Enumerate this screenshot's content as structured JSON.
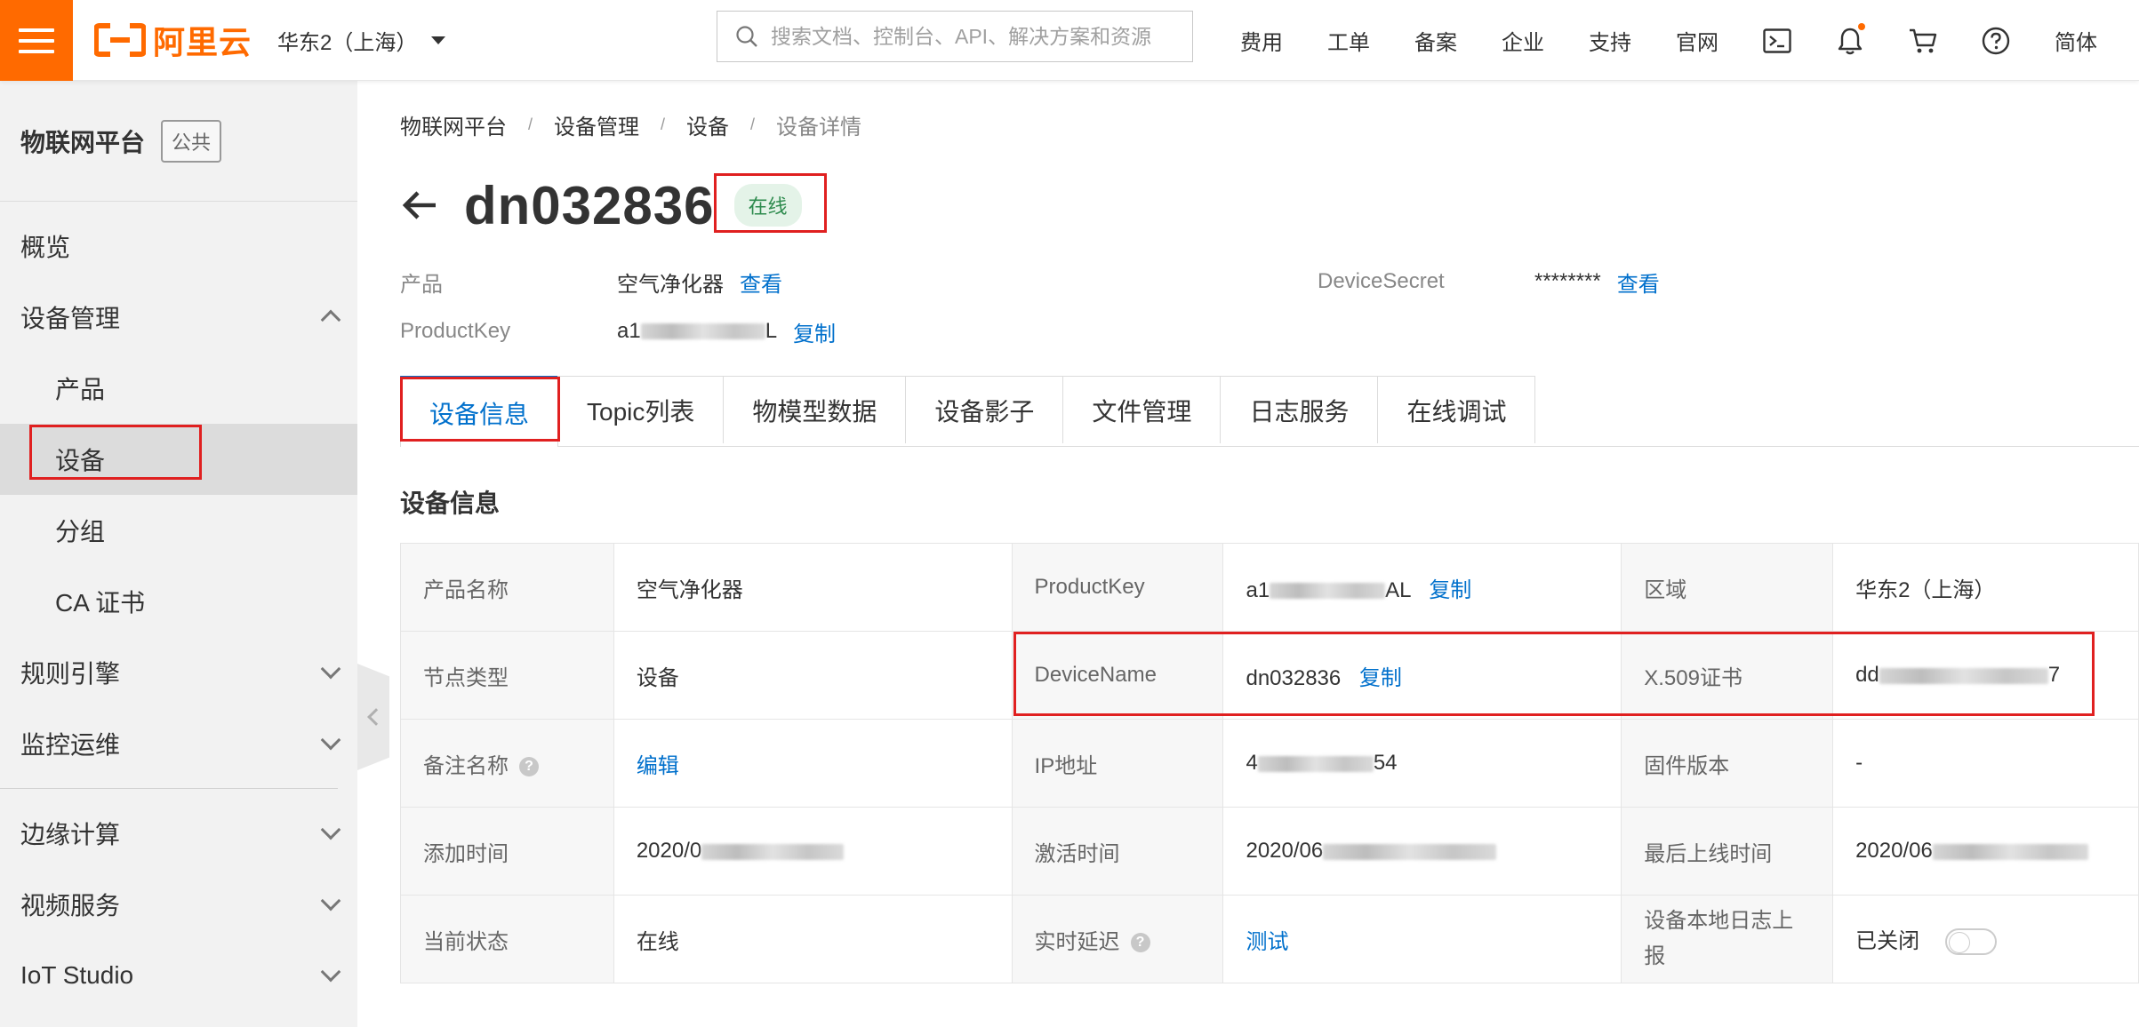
{
  "colors": {
    "brand": "#ff6a00",
    "link": "#0070cc",
    "highlight": "#e02020",
    "online": "#2e8b4e"
  },
  "topbar": {
    "logo_text": "阿里云",
    "region": "华东2（上海）",
    "search_placeholder": "搜索文档、控制台、API、解决方案和资源",
    "nav": [
      "费用",
      "工单",
      "备案",
      "企业",
      "支持",
      "官网"
    ],
    "icons": [
      "terminal-icon",
      "bell-icon",
      "cart-icon",
      "help-icon"
    ],
    "lang": "简体"
  },
  "sidebar": {
    "title": "物联网平台",
    "tag": "公共",
    "items": [
      {
        "label": "概览",
        "level": 1
      },
      {
        "label": "设备管理",
        "level": 1,
        "expanded": true
      },
      {
        "label": "产品",
        "level": 2
      },
      {
        "label": "设备",
        "level": 2,
        "active": true
      },
      {
        "label": "分组",
        "level": 2
      },
      {
        "label": "CA 证书",
        "level": 2
      },
      {
        "label": "规则引擎",
        "level": 1
      },
      {
        "label": "监控运维",
        "level": 1
      },
      {
        "label": "边缘计算",
        "level": 1
      },
      {
        "label": "视频服务",
        "level": 1
      },
      {
        "label": "IoT Studio",
        "level": 1
      }
    ]
  },
  "breadcrumb": [
    "物联网平台",
    "设备管理",
    "设备",
    "设备详情"
  ],
  "device": {
    "name": "dn032836",
    "status": "在线"
  },
  "meta": {
    "product_label": "产品",
    "product_value": "空气净化器",
    "view_label": "查看",
    "productkey_label": "ProductKey",
    "productkey_value_start": "a1",
    "productkey_value_end": "L",
    "copy_label": "复制",
    "secret_label": "DeviceSecret",
    "secret_value": "********",
    "secret_view": "查看"
  },
  "tabs": [
    "设备信息",
    "Topic列表",
    "物模型数据",
    "设备影子",
    "文件管理",
    "日志服务",
    "在线调试"
  ],
  "section_title": "设备信息",
  "info": {
    "r1": {
      "k1": "产品名称",
      "v1": "空气净化器",
      "k2": "ProductKey",
      "v2_start": "a1",
      "v2_end": "AL",
      "v2_link": "复制",
      "k3": "区域",
      "v3": "华东2（上海）"
    },
    "r2": {
      "k1": "节点类型",
      "v1": "设备",
      "k2": "DeviceName",
      "v2": "dn032836",
      "v2_link": "复制",
      "k3": "X.509证书",
      "v3_start": "dd",
      "v3_end": "7"
    },
    "r3": {
      "k1": "备注名称",
      "v1_link": "编辑",
      "k2": "IP地址",
      "v2_start": "4",
      "v2_end": "54",
      "k3": "固件版本",
      "v3": "-"
    },
    "r4": {
      "k1": "添加时间",
      "v1_start": "2020/0",
      "k2": "激活时间",
      "v2_start": "2020/06",
      "k3": "最后上线时间",
      "v3_start": "2020/06"
    },
    "r5": {
      "k1": "当前状态",
      "v1": "在线",
      "k2": "实时延迟",
      "v2_link": "测试",
      "k3": "设备本地日志上报",
      "v3": "已关闭",
      "v3_toggle_on": false
    }
  }
}
